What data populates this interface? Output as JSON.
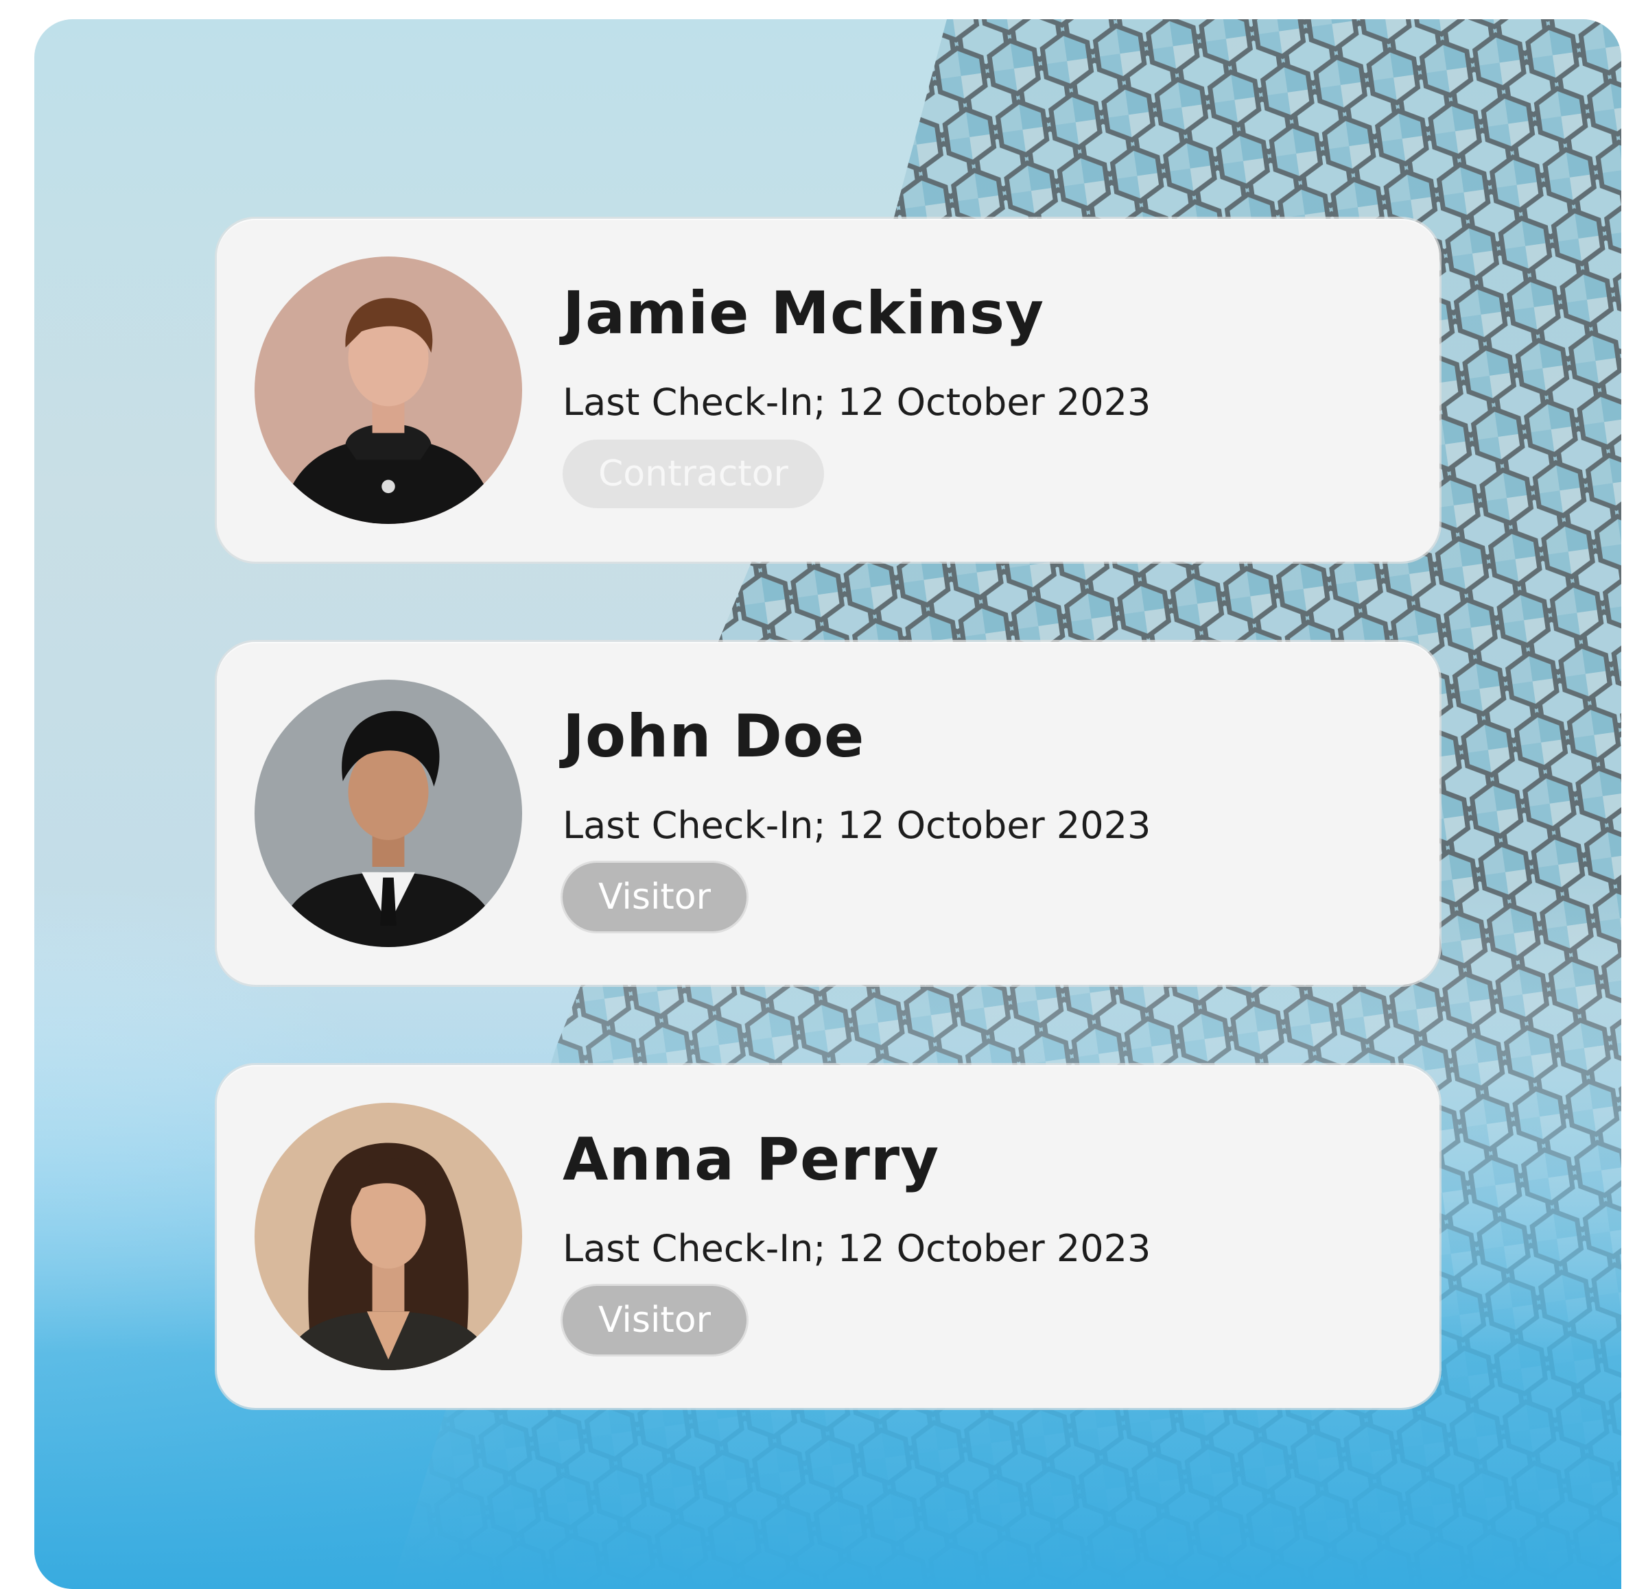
{
  "visitors": [
    {
      "name": "Jamie Mckinsy",
      "last_check_in": "Last Check-In; 12 October 2023",
      "role": "Contractor",
      "role_color": "#e3e3e3"
    },
    {
      "name": "John Doe",
      "last_check_in": "Last Check-In; 12 October 2023",
      "role": "Visitor",
      "role_color": "#b8b8b8"
    },
    {
      "name": "Anna Perry",
      "last_check_in": "Last Check-In; 12 October 2023",
      "role": "Visitor",
      "role_color": "#b8b8b8"
    }
  ],
  "colors": {
    "card_background": "#f4f4f4",
    "text_primary": "#1b1b1b",
    "sky_blue": "#2ea3d8"
  },
  "icons": {
    "avatar_1": "person-photo-icon",
    "avatar_2": "person-photo-icon",
    "avatar_3": "person-photo-icon"
  }
}
